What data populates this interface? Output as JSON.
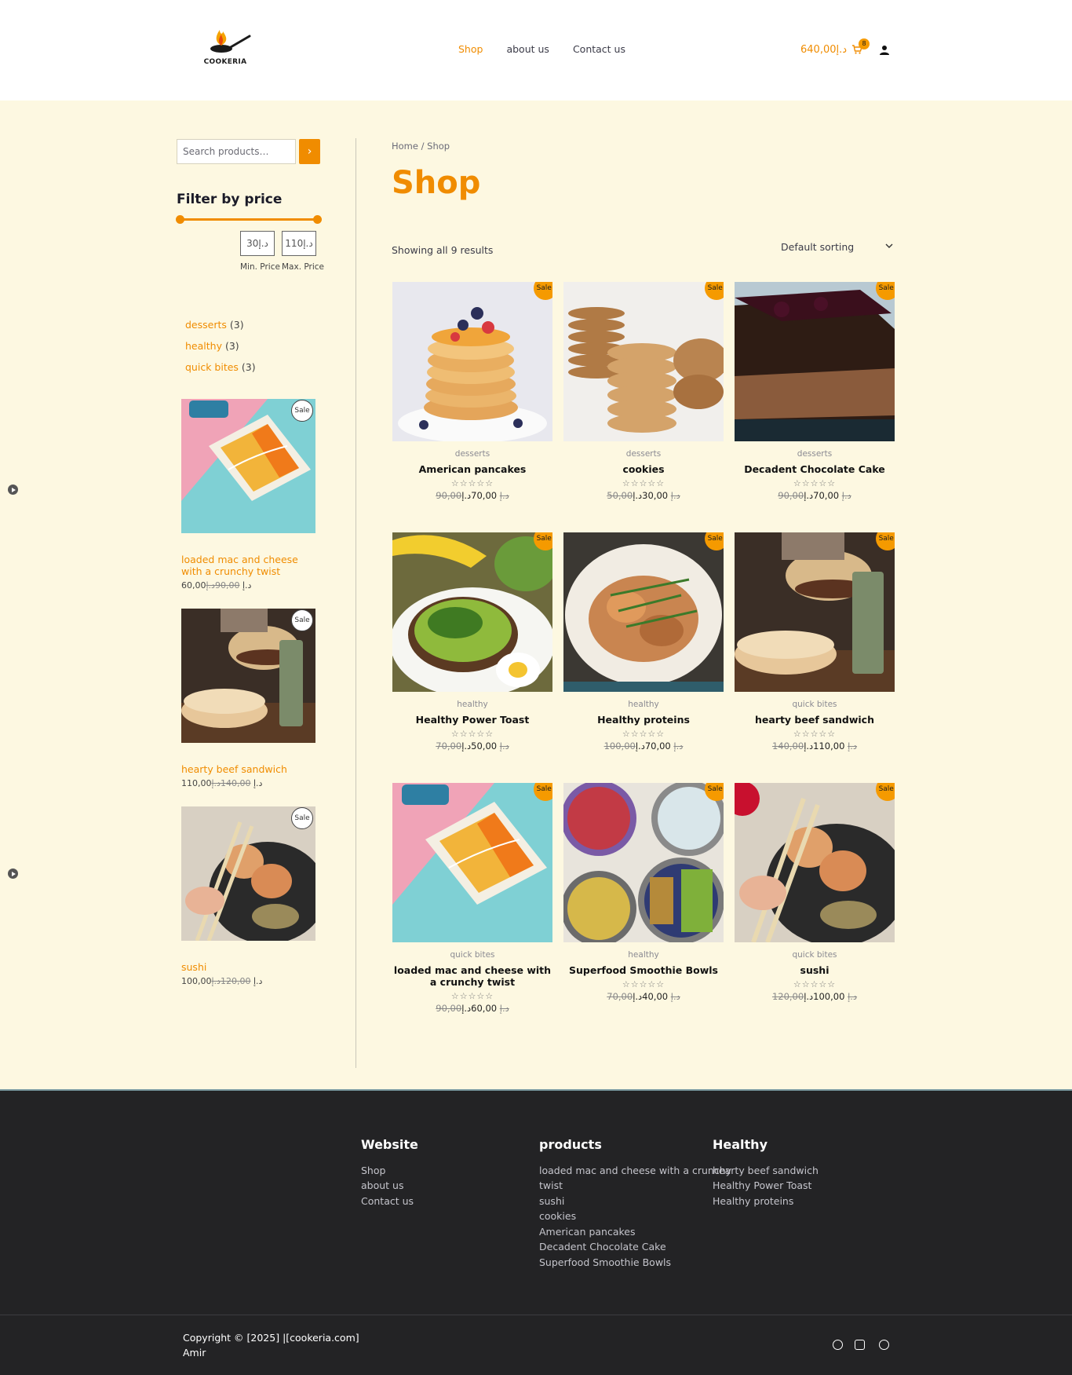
{
  "header": {
    "logo_text": "COOKERIA",
    "nav": [
      "Shop",
      "about us",
      "Contact us"
    ],
    "cart_total": "640,00د.إ",
    "cart_count": "8"
  },
  "sidebar": {
    "search_placeholder": "Search products…",
    "search_button": "›",
    "filter_title": "Filter by price",
    "min_price": "30د.إ",
    "max_price": "110د.إ",
    "min_label": "Min. Price",
    "max_label": "Max. Price",
    "categories": [
      {
        "name": "desserts",
        "count": "(3)"
      },
      {
        "name": "healthy",
        "count": "(3)"
      },
      {
        "name": "quick bites",
        "count": "(3)"
      }
    ],
    "featured": [
      {
        "name": "loaded mac and cheese with a crunchy twist",
        "price": "60,00د.إ",
        "old_price": "90,00د.إ",
        "badge": "Sale"
      },
      {
        "name": "hearty beef sandwich",
        "price": "110,00د.إ",
        "old_price": "140,00د.إ",
        "badge": "Sale"
      },
      {
        "name": "sushi",
        "price": "100,00د.إ",
        "old_price": "120,00د.إ",
        "badge": "Sale"
      }
    ]
  },
  "main": {
    "breadcrumb": "Home / Shop",
    "title": "Shop",
    "results": "Showing all 9 results",
    "sorting": "Default sorting",
    "products": [
      {
        "category": "desserts",
        "name": "American pancakes",
        "old_price": "90,00د.إ",
        "price": "70,00د.إ",
        "badge": "Sale!"
      },
      {
        "category": "desserts",
        "name": "cookies",
        "old_price": "50,00د.إ",
        "price": "30,00د.إ",
        "badge": "Sale!"
      },
      {
        "category": "desserts",
        "name": "Decadent Chocolate Cake",
        "old_price": "90,00د.إ",
        "price": "70,00د.إ",
        "badge": "Sale!"
      },
      {
        "category": "healthy",
        "name": "Healthy Power Toast",
        "old_price": "70,00د.إ",
        "price": "50,00د.إ",
        "badge": "Sale!"
      },
      {
        "category": "healthy",
        "name": "Healthy proteins",
        "old_price": "100,00د.إ",
        "price": "70,00د.إ",
        "badge": "Sale!"
      },
      {
        "category": "quick bites",
        "name": "hearty beef sandwich",
        "old_price": "140,00د.إ",
        "price": "110,00د.إ",
        "badge": "Sale!"
      },
      {
        "category": "quick bites",
        "name": "loaded mac and cheese with a crunchy twist",
        "old_price": "90,00د.إ",
        "price": "60,00د.إ",
        "badge": "Sale!"
      },
      {
        "category": "healthy",
        "name": "Superfood Smoothie Bowls",
        "old_price": "70,00د.إ",
        "price": "40,00د.إ",
        "badge": "Sale!"
      },
      {
        "category": "quick bites",
        "name": "sushi",
        "old_price": "120,00د.إ",
        "price": "100,00د.إ",
        "badge": "Sale!"
      }
    ],
    "stars": "☆☆☆☆☆"
  },
  "footer": {
    "website_title": "Website",
    "website_links": [
      "Shop",
      "about us",
      "Contact us"
    ],
    "products_title": "products",
    "products_links": [
      "loaded mac and cheese with a crunchy",
      "twist",
      "sushi",
      "cookies",
      "American pancakes",
      "Decadent Chocolate Cake",
      "Superfood Smoothie Bowls"
    ],
    "healthy_title": "Healthy",
    "healthy_links": [
      "hearty beef sandwich",
      "Healthy Power Toast",
      "Healthy proteins"
    ],
    "copyright_line1": "Copyright © [2025] |[cookeria.com]",
    "copyright_line2": "Amir"
  },
  "colors": {
    "accent": "#f08c00",
    "page_bg": "#fdf8e1",
    "footer_bg": "#232325"
  },
  "icons": [
    "flame-pan-logo-icon",
    "cart-icon",
    "user-icon",
    "chevron-right-icon",
    "chevron-down-icon",
    "facebook-icon",
    "instagram-icon",
    "telegram-icon"
  ]
}
